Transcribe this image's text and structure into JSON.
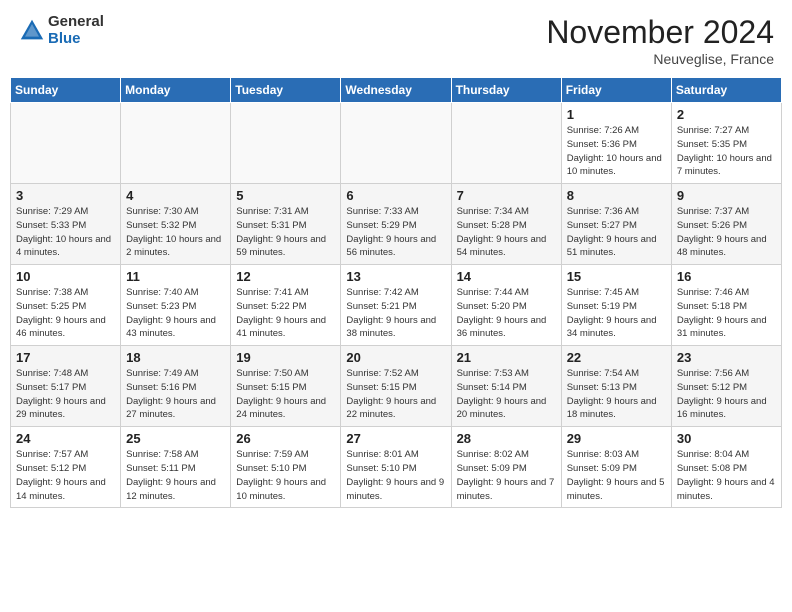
{
  "header": {
    "logo_general": "General",
    "logo_blue": "Blue",
    "month_title": "November 2024",
    "subtitle": "Neuveglise, France"
  },
  "calendar": {
    "headers": [
      "Sunday",
      "Monday",
      "Tuesday",
      "Wednesday",
      "Thursday",
      "Friday",
      "Saturday"
    ],
    "weeks": [
      [
        {
          "day": "",
          "info": ""
        },
        {
          "day": "",
          "info": ""
        },
        {
          "day": "",
          "info": ""
        },
        {
          "day": "",
          "info": ""
        },
        {
          "day": "",
          "info": ""
        },
        {
          "day": "1",
          "info": "Sunrise: 7:26 AM\nSunset: 5:36 PM\nDaylight: 10 hours and 10 minutes."
        },
        {
          "day": "2",
          "info": "Sunrise: 7:27 AM\nSunset: 5:35 PM\nDaylight: 10 hours and 7 minutes."
        }
      ],
      [
        {
          "day": "3",
          "info": "Sunrise: 7:29 AM\nSunset: 5:33 PM\nDaylight: 10 hours and 4 minutes."
        },
        {
          "day": "4",
          "info": "Sunrise: 7:30 AM\nSunset: 5:32 PM\nDaylight: 10 hours and 2 minutes."
        },
        {
          "day": "5",
          "info": "Sunrise: 7:31 AM\nSunset: 5:31 PM\nDaylight: 9 hours and 59 minutes."
        },
        {
          "day": "6",
          "info": "Sunrise: 7:33 AM\nSunset: 5:29 PM\nDaylight: 9 hours and 56 minutes."
        },
        {
          "day": "7",
          "info": "Sunrise: 7:34 AM\nSunset: 5:28 PM\nDaylight: 9 hours and 54 minutes."
        },
        {
          "day": "8",
          "info": "Sunrise: 7:36 AM\nSunset: 5:27 PM\nDaylight: 9 hours and 51 minutes."
        },
        {
          "day": "9",
          "info": "Sunrise: 7:37 AM\nSunset: 5:26 PM\nDaylight: 9 hours and 48 minutes."
        }
      ],
      [
        {
          "day": "10",
          "info": "Sunrise: 7:38 AM\nSunset: 5:25 PM\nDaylight: 9 hours and 46 minutes."
        },
        {
          "day": "11",
          "info": "Sunrise: 7:40 AM\nSunset: 5:23 PM\nDaylight: 9 hours and 43 minutes."
        },
        {
          "day": "12",
          "info": "Sunrise: 7:41 AM\nSunset: 5:22 PM\nDaylight: 9 hours and 41 minutes."
        },
        {
          "day": "13",
          "info": "Sunrise: 7:42 AM\nSunset: 5:21 PM\nDaylight: 9 hours and 38 minutes."
        },
        {
          "day": "14",
          "info": "Sunrise: 7:44 AM\nSunset: 5:20 PM\nDaylight: 9 hours and 36 minutes."
        },
        {
          "day": "15",
          "info": "Sunrise: 7:45 AM\nSunset: 5:19 PM\nDaylight: 9 hours and 34 minutes."
        },
        {
          "day": "16",
          "info": "Sunrise: 7:46 AM\nSunset: 5:18 PM\nDaylight: 9 hours and 31 minutes."
        }
      ],
      [
        {
          "day": "17",
          "info": "Sunrise: 7:48 AM\nSunset: 5:17 PM\nDaylight: 9 hours and 29 minutes."
        },
        {
          "day": "18",
          "info": "Sunrise: 7:49 AM\nSunset: 5:16 PM\nDaylight: 9 hours and 27 minutes."
        },
        {
          "day": "19",
          "info": "Sunrise: 7:50 AM\nSunset: 5:15 PM\nDaylight: 9 hours and 24 minutes."
        },
        {
          "day": "20",
          "info": "Sunrise: 7:52 AM\nSunset: 5:15 PM\nDaylight: 9 hours and 22 minutes."
        },
        {
          "day": "21",
          "info": "Sunrise: 7:53 AM\nSunset: 5:14 PM\nDaylight: 9 hours and 20 minutes."
        },
        {
          "day": "22",
          "info": "Sunrise: 7:54 AM\nSunset: 5:13 PM\nDaylight: 9 hours and 18 minutes."
        },
        {
          "day": "23",
          "info": "Sunrise: 7:56 AM\nSunset: 5:12 PM\nDaylight: 9 hours and 16 minutes."
        }
      ],
      [
        {
          "day": "24",
          "info": "Sunrise: 7:57 AM\nSunset: 5:12 PM\nDaylight: 9 hours and 14 minutes."
        },
        {
          "day": "25",
          "info": "Sunrise: 7:58 AM\nSunset: 5:11 PM\nDaylight: 9 hours and 12 minutes."
        },
        {
          "day": "26",
          "info": "Sunrise: 7:59 AM\nSunset: 5:10 PM\nDaylight: 9 hours and 10 minutes."
        },
        {
          "day": "27",
          "info": "Sunrise: 8:01 AM\nSunset: 5:10 PM\nDaylight: 9 hours and 9 minutes."
        },
        {
          "day": "28",
          "info": "Sunrise: 8:02 AM\nSunset: 5:09 PM\nDaylight: 9 hours and 7 minutes."
        },
        {
          "day": "29",
          "info": "Sunrise: 8:03 AM\nSunset: 5:09 PM\nDaylight: 9 hours and 5 minutes."
        },
        {
          "day": "30",
          "info": "Sunrise: 8:04 AM\nSunset: 5:08 PM\nDaylight: 9 hours and 4 minutes."
        }
      ]
    ]
  }
}
